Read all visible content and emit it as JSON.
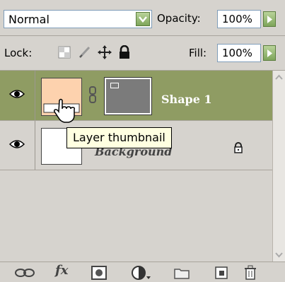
{
  "blend": {
    "value": "Normal"
  },
  "opacity": {
    "label": "Opacity:",
    "value": "100%"
  },
  "lock": {
    "label": "Lock:"
  },
  "fill": {
    "label": "Fill:",
    "value": "100%"
  },
  "layers": [
    {
      "name": "Shape 1",
      "selected": true,
      "thumb_color": "#fdd2ae"
    },
    {
      "name": "Background",
      "selected": false
    }
  ],
  "tooltip": {
    "text": "Layer thumbnail"
  },
  "bottom": {
    "fx_label": "fx"
  },
  "colors": {
    "selection": "#8f9c63",
    "accent_button": "#7ea55a",
    "tooltip_bg": "#ffffe1"
  }
}
